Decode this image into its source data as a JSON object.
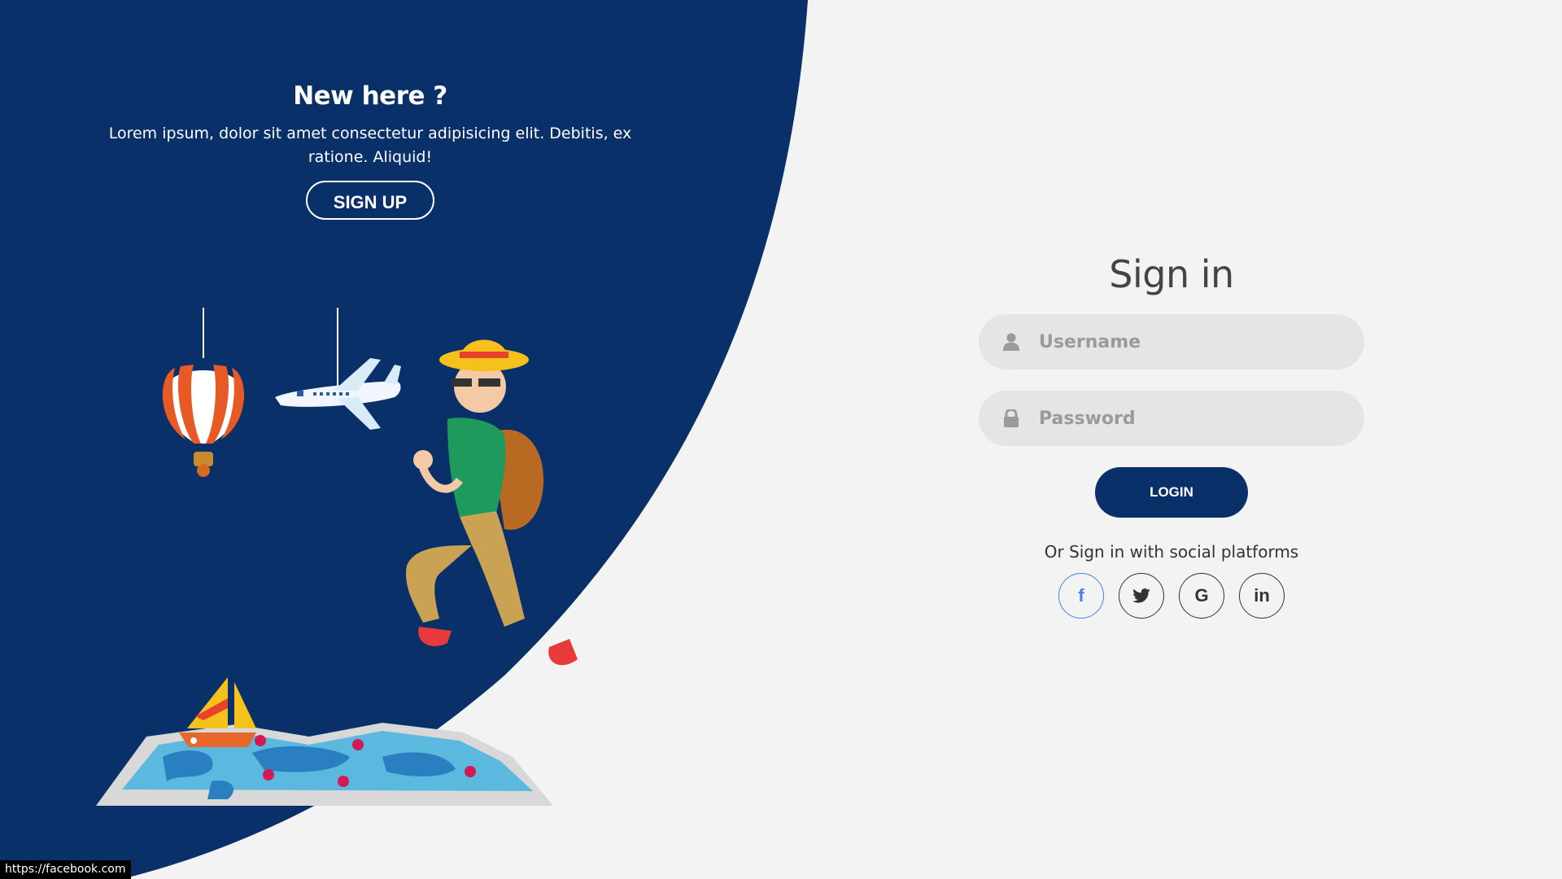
{
  "left_panel": {
    "title": "New here ?",
    "text": "Lorem ipsum, dolor sit amet consectetur adipisicing elit. Debitis, ex ratione. Aliquid!",
    "signup_label": "SIGN UP",
    "background_color": "#0a3069"
  },
  "form": {
    "title": "Sign in",
    "username_placeholder": "Username",
    "password_placeholder": "Password",
    "login_label": "LOGIN",
    "social_text": "Or Sign in with social platforms",
    "social": [
      {
        "name": "facebook",
        "glyph": "f"
      },
      {
        "name": "twitter",
        "glyph": "twitter-icon"
      },
      {
        "name": "google",
        "glyph": "G"
      },
      {
        "name": "linkedin",
        "glyph": "in"
      }
    ]
  },
  "status_bar": {
    "url": "https://facebook.com"
  }
}
